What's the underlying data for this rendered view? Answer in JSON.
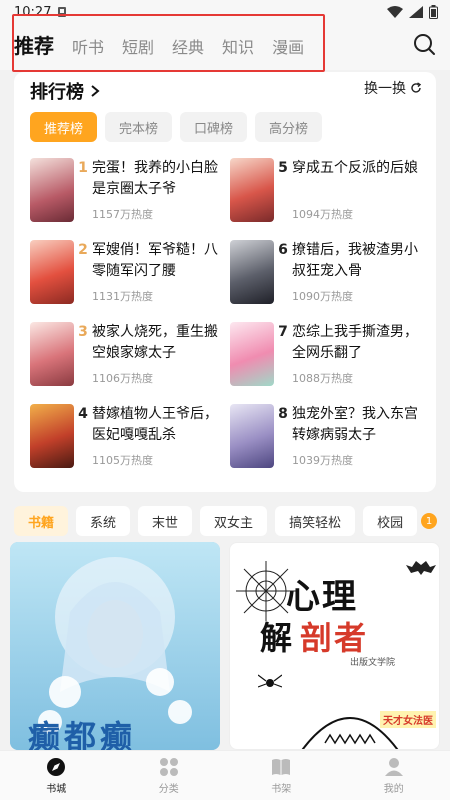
{
  "status_bar": {
    "time": "10:27"
  },
  "top_nav": {
    "tabs": [
      "推荐",
      "听书",
      "短剧",
      "经典",
      "知识",
      "漫画"
    ],
    "active_tab": "推荐"
  },
  "ranking": {
    "title": "排行榜",
    "refresh_label": "换一换",
    "tabs": [
      "推荐榜",
      "完本榜",
      "口碑榜",
      "高分榜"
    ],
    "active_tab": "推荐榜",
    "books": [
      {
        "rank": "1",
        "title": "完蛋！我养的小白脸是京圈太子爷",
        "heat": "1157万热度"
      },
      {
        "rank": "5",
        "title": "穿成五个反派的后娘",
        "heat": "1094万热度"
      },
      {
        "rank": "2",
        "title": "军嫂俏！军爷糙！八零随军闪了腰",
        "heat": "1131万热度"
      },
      {
        "rank": "6",
        "title": "撩错后，我被渣男小叔狂宠入骨",
        "heat": "1090万热度"
      },
      {
        "rank": "3",
        "title": "被家人烧死，重生搬空娘家嫁太子",
        "heat": "1106万热度"
      },
      {
        "rank": "7",
        "title": "恋综上我手撕渣男，全网乐翻了",
        "heat": "1088万热度"
      },
      {
        "rank": "4",
        "title": "替嫁植物人王爷后，医妃嘎嘎乱杀",
        "heat": "1105万热度"
      },
      {
        "rank": "8",
        "title": "独宠外室？我入东宫转嫁病弱太子",
        "heat": "1039万热度"
      }
    ]
  },
  "categories": {
    "items": [
      "书籍",
      "系统",
      "末世",
      "双女主",
      "搞笑轻松",
      "校园"
    ],
    "active": "书籍",
    "badge": "1"
  },
  "feed": {
    "left_cover_text": "癫都癫",
    "right_cover_title_a": "心理",
    "right_cover_title_b": "解",
    "right_cover_title_c": "剖者",
    "right_cover_tag": "天才女法医",
    "right_cover_author": "出版文学院"
  },
  "bottom_nav": {
    "items": [
      "书城",
      "分类",
      "书架",
      "我的"
    ],
    "active": "书城"
  },
  "colors": {
    "accent": "#ffa51f",
    "highlight_border": "#e53935",
    "rank_top": "#e9a95a"
  }
}
